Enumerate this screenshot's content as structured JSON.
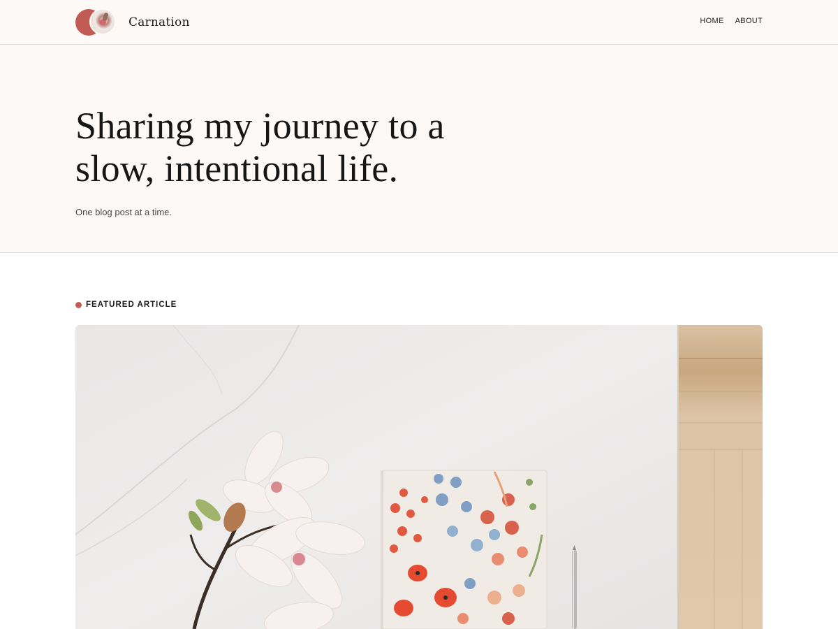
{
  "header": {
    "site_name": "Carnation",
    "nav": [
      {
        "label": "HOME"
      },
      {
        "label": "ABOUT"
      }
    ]
  },
  "hero": {
    "title_line_1": "Sharing my journey to a",
    "title_line_2": "slow, intentional life.",
    "subtitle": "One blog post at a time."
  },
  "featured": {
    "label": "FEATURED ARTICLE",
    "image_icon": "flowers-notebook-photo"
  },
  "colors": {
    "accent": "#c15b53",
    "header_bg": "#fdf9f6",
    "divider": "#dcd9d7"
  }
}
